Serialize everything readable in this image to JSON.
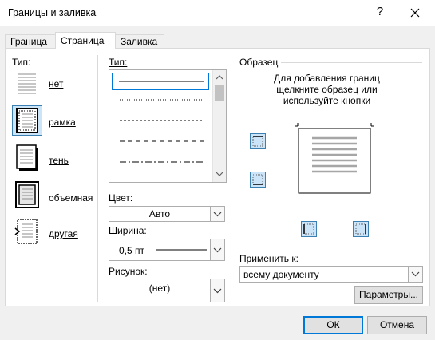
{
  "window": {
    "title": "Границы и заливка",
    "help": "?",
    "close": "✕"
  },
  "tabs": [
    {
      "label": "Граница"
    },
    {
      "label": "Страница"
    },
    {
      "label": "Заливка"
    }
  ],
  "setting": {
    "header": "Тип:",
    "items": [
      {
        "label": "нет"
      },
      {
        "label": "рамка"
      },
      {
        "label": "тень"
      },
      {
        "label": "объемная"
      },
      {
        "label": "другая"
      }
    ]
  },
  "style": {
    "header": "Тип:"
  },
  "color": {
    "label": "Цвет:",
    "value": "Авто"
  },
  "width": {
    "label": "Ширина:",
    "value": "0,5 пт"
  },
  "art": {
    "label": "Рисунок:",
    "value": "(нет)"
  },
  "preview": {
    "header": "Образец",
    "hint_line1": "Для добавления границ",
    "hint_line2": "щелкните образец или",
    "hint_line3": "используйте кнопки"
  },
  "apply": {
    "label": "Применить к:",
    "value": "всему документу"
  },
  "buttons": {
    "options": "Параметры...",
    "ok": "ОК",
    "cancel": "Отмена"
  },
  "colors": {
    "accent": "#0078d7",
    "selection": "#cce4f7"
  }
}
